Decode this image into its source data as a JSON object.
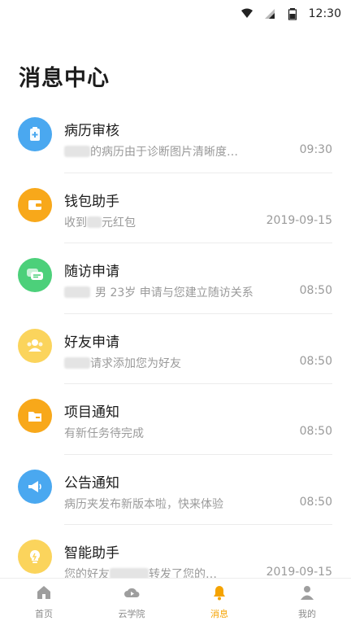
{
  "status_bar": {
    "time": "12:30",
    "icons": [
      "wifi-icon",
      "signal-icon",
      "battery-icon"
    ]
  },
  "page": {
    "title": "消息中心"
  },
  "accent": "#f5a300",
  "messages": [
    {
      "icon": "medical-record-icon",
      "color": "#4aa8f0",
      "title": "病历审核",
      "preview_prefix": "",
      "preview": "的病历由于诊断图片清晰度…",
      "time": "09:30",
      "has_blur": true
    },
    {
      "icon": "wallet-icon",
      "color": "#f8a81a",
      "title": "钱包助手",
      "preview_prefix": "收到",
      "preview": "元红包",
      "time": "2019-09-15",
      "has_blur": true
    },
    {
      "icon": "chat-icon",
      "color": "#4cd07a",
      "title": "随访申请",
      "preview_prefix": "",
      "preview": "男 23岁 申请与您建立随访关系",
      "time": "08:50",
      "has_blur": true
    },
    {
      "icon": "friends-icon",
      "color": "#fbd45c",
      "title": "好友申请",
      "preview_prefix": "",
      "preview": "请求添加您为好友",
      "time": "08:50",
      "has_blur": true
    },
    {
      "icon": "folder-icon",
      "color": "#f8a81a",
      "title": "项目通知",
      "preview_prefix": "",
      "preview": "有新任务待完成",
      "time": "08:50",
      "has_blur": false
    },
    {
      "icon": "megaphone-icon",
      "color": "#4aa8f0",
      "title": "公告通知",
      "preview_prefix": "",
      "preview": "病历夹发布新版本啦，快来体验",
      "time": "08:50",
      "has_blur": false
    },
    {
      "icon": "lightbulb-icon",
      "color": "#fbd45c",
      "title": "智能助手",
      "preview_prefix": "您的好友",
      "preview": "转发了您的…",
      "time": "2019-09-15",
      "has_blur": true
    }
  ],
  "tabbar": [
    {
      "label": "首页",
      "icon": "home-icon",
      "active": false
    },
    {
      "label": "云学院",
      "icon": "cloud-play-icon",
      "active": false
    },
    {
      "label": "消息",
      "icon": "bell-icon",
      "active": true
    },
    {
      "label": "我的",
      "icon": "profile-icon",
      "active": false
    }
  ]
}
